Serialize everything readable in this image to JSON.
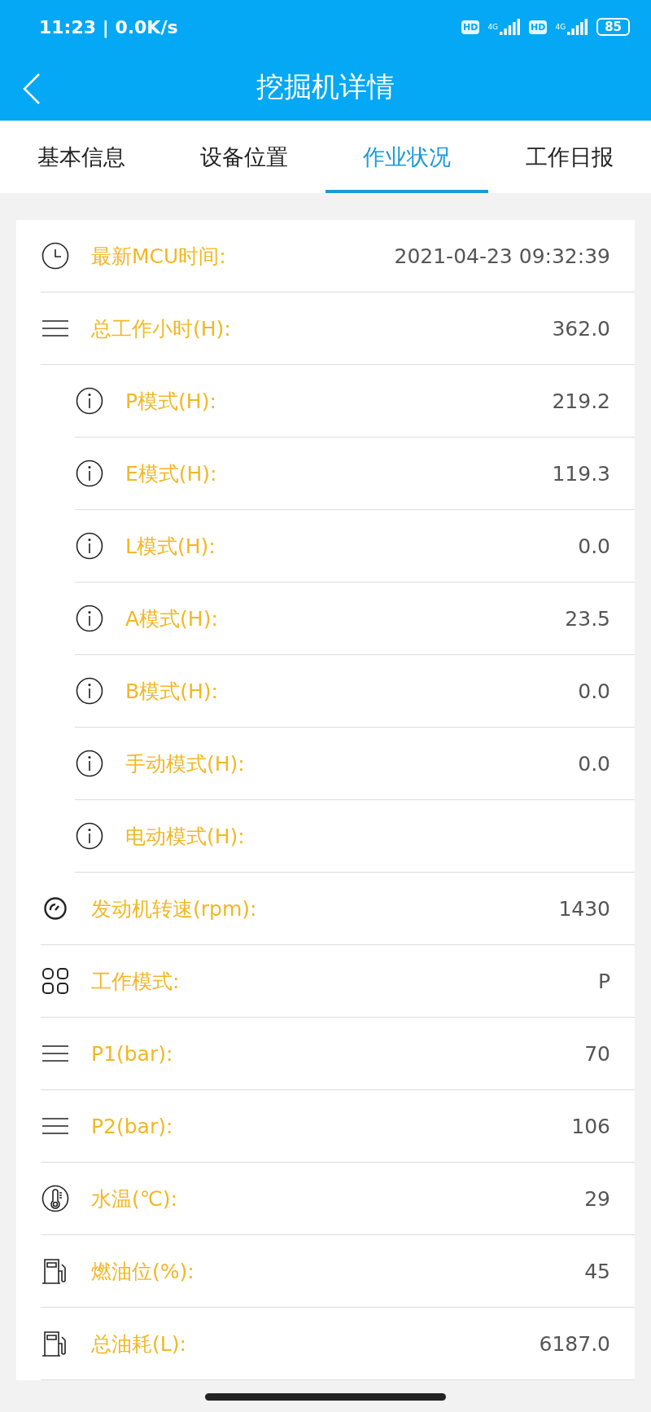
{
  "status_bar": {
    "time": "11:23 | 0.0K/s",
    "sim_1": {
      "hd": "HD",
      "network": "4G"
    },
    "sim_2": {
      "hd": "HD",
      "network": "4G"
    },
    "battery": "85"
  },
  "header": {
    "title": "挖掘机详情"
  },
  "tabs": [
    {
      "label": "基本信息",
      "selected": false
    },
    {
      "label": "设备位置",
      "selected": false
    },
    {
      "label": "作业状况",
      "selected": true
    },
    {
      "label": "工作日报",
      "selected": false
    }
  ],
  "rows": [
    {
      "kind": "clock",
      "label": "最新MCU时间:",
      "value": "2021-04-23 09:32:39"
    },
    {
      "kind": "lines",
      "label": "总工作小时(H):",
      "value": "362.0",
      "children": [
        {
          "kind": "info",
          "label": "P模式(H):",
          "value": "219.2"
        },
        {
          "kind": "info",
          "label": "E模式(H):",
          "value": "119.3"
        },
        {
          "kind": "info",
          "label": "L模式(H):",
          "value": "0.0"
        },
        {
          "kind": "info",
          "label": "A模式(H):",
          "value": "23.5"
        },
        {
          "kind": "info",
          "label": "B模式(H):",
          "value": "0.0"
        },
        {
          "kind": "info",
          "label": "手动模式(H):",
          "value": "0.0"
        },
        {
          "kind": "info",
          "label": "电动模式(H):"
        }
      ]
    },
    {
      "kind": "gauge",
      "label": "发动机转速(rpm):",
      "value": "1430"
    },
    {
      "kind": "grid",
      "label": "工作模式:",
      "value": "P"
    },
    {
      "kind": "lines",
      "label": "P1(bar):",
      "value": "70"
    },
    {
      "kind": "lines",
      "label": "P2(bar):",
      "value": "106"
    },
    {
      "kind": "thermometer",
      "label": "水温(℃):",
      "value": "29"
    },
    {
      "kind": "fuel",
      "label": "燃油位(%):",
      "value": "45"
    },
    {
      "kind": "fuel",
      "label": "总油耗(L):",
      "value": "6187.0"
    }
  ]
}
